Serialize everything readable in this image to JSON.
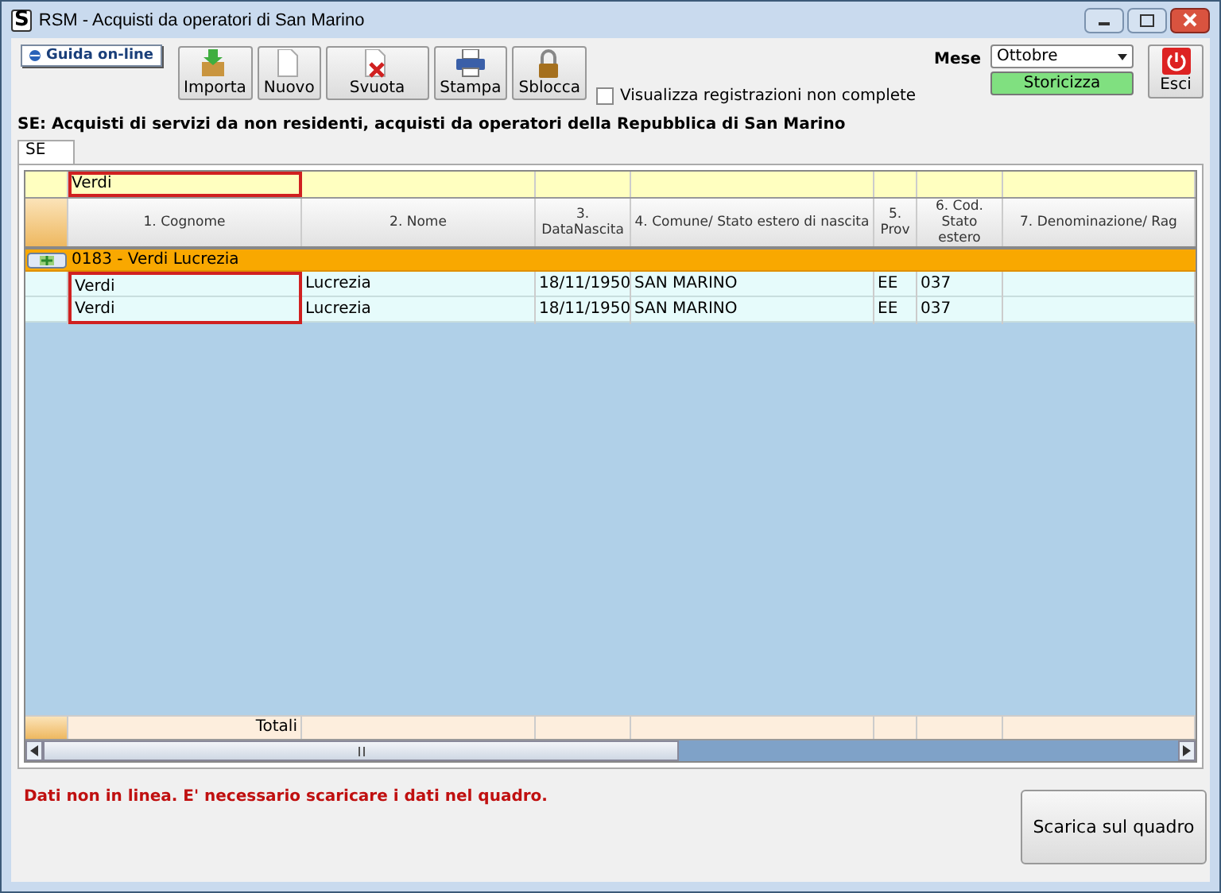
{
  "window": {
    "title": "RSM - Acquisti da operatori di San Marino",
    "icon_text": "S"
  },
  "help_button": "Guida on-line",
  "toolbar": [
    {
      "label": "Importa",
      "kind": "import"
    },
    {
      "label": "Nuovo",
      "kind": "new"
    },
    {
      "label": "Svuota",
      "kind": "clear"
    },
    {
      "label": "Stampa",
      "kind": "print"
    },
    {
      "label": "Sblocca",
      "kind": "unlock"
    }
  ],
  "show_incomplete": {
    "label": "Visualizza registrazioni non complete",
    "checked": false
  },
  "month": {
    "label": "Mese",
    "value": "Ottobre"
  },
  "archive_button": "Storicizza",
  "exit_button": "Esci",
  "heading": "SE: Acquisti di servizi da non residenti, acquisti da operatori della Repubblica di San Marino",
  "tabs": [
    {
      "label": "SE",
      "selected": true
    }
  ],
  "grid": {
    "filter": {
      "value": "Verdi",
      "highlighted": true
    },
    "columns": [
      "1. Cognome",
      "2. Nome",
      "3. DataNascita",
      "4. Comune/ Stato estero di nascita",
      "5. Prov",
      "6. Cod. Stato estero",
      "7. Denominazione/ Rag"
    ],
    "groups": [
      {
        "title": "0183 - Verdi Lucrezia",
        "rows": [
          {
            "cells": [
              "Verdi",
              "Lucrezia",
              "18/11/1950",
              "SAN MARINO",
              "EE",
              "037"
            ],
            "highlighted": true
          },
          {
            "cells": [
              "Verdi",
              "Lucrezia",
              "18/11/1950",
              "SAN MARINO",
              "EE",
              "037"
            ],
            "highlighted": true
          }
        ]
      }
    ],
    "totals_label": "Totali"
  },
  "status_message": "Dati non in linea. E' necessario scaricare i dati nel quadro.",
  "download_button": "Scarica sul quadro"
}
